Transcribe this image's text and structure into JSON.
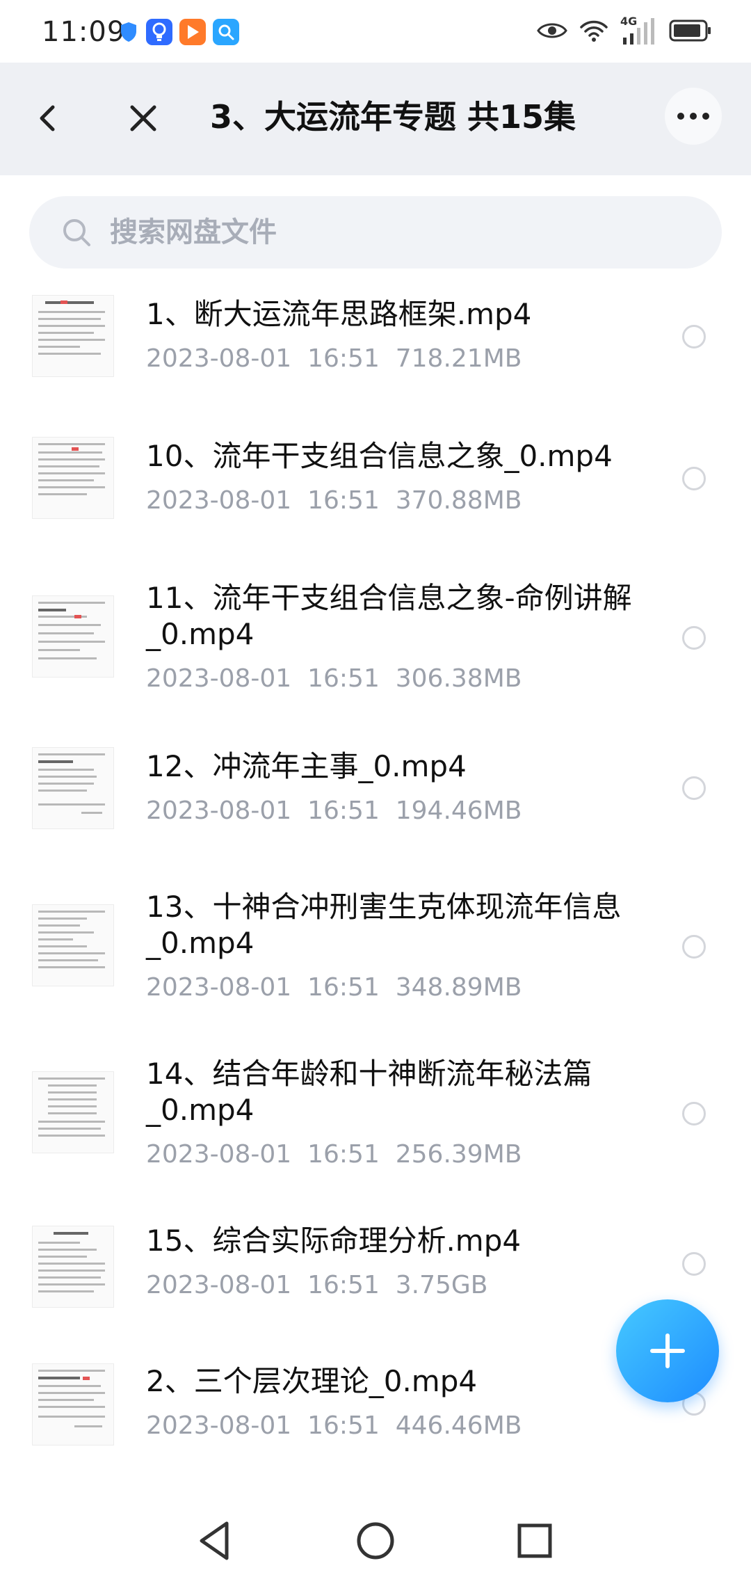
{
  "status_bar": {
    "time": "11:09",
    "network_label": "4G",
    "app_icons": [
      "shield-icon",
      "bulb-icon",
      "play-icon",
      "search-app-icon"
    ],
    "right_icons": [
      "eye-icon",
      "wifi-icon",
      "signal-icon",
      "battery-icon"
    ]
  },
  "header": {
    "title": "3、大运流年专题 共15集",
    "back_icon": "chevron-left-icon",
    "close_icon": "close-icon",
    "more_icon": "more-horizontal-icon"
  },
  "search": {
    "placeholder": "搜索网盘文件",
    "icon": "search-icon"
  },
  "files": [
    {
      "name": "1、断大运流年思路框架.mp4",
      "date": "2023-08-01",
      "time": "16:51",
      "size": "718.21MB"
    },
    {
      "name": "10、流年干支组合信息之象_0.mp4",
      "date": "2023-08-01",
      "time": "16:51",
      "size": "370.88MB"
    },
    {
      "name": "11、流年干支组合信息之象-命例讲解_0.mp4",
      "date": "2023-08-01",
      "time": "16:51",
      "size": "306.38MB"
    },
    {
      "name": "12、冲流年主事_0.mp4",
      "date": "2023-08-01",
      "time": "16:51",
      "size": "194.46MB"
    },
    {
      "name": "13、十神合冲刑害生克体现流年信息_0.mp4",
      "date": "2023-08-01",
      "time": "16:51",
      "size": "348.89MB"
    },
    {
      "name": "14、结合年龄和十神断流年秘法篇_0.mp4",
      "date": "2023-08-01",
      "time": "16:51",
      "size": "256.39MB"
    },
    {
      "name": "15、综合实际命理分析.mp4",
      "date": "2023-08-01",
      "time": "16:51",
      "size": "3.75GB"
    },
    {
      "name": "2、三个层次理论_0.mp4",
      "date": "2023-08-01",
      "time": "16:51",
      "size": "446.46MB"
    }
  ],
  "fab": {
    "icon": "plus-icon"
  },
  "nav": {
    "back_icon": "nav-back-triangle-icon",
    "home_icon": "nav-home-circle-icon",
    "recents_icon": "nav-recents-square-icon"
  },
  "colors": {
    "header_bg": "#eef0f4",
    "search_bg": "#f1f3f7",
    "meta_text": "#9ba0aa",
    "fab_start": "#46c9ff",
    "fab_end": "#1d8cff"
  }
}
